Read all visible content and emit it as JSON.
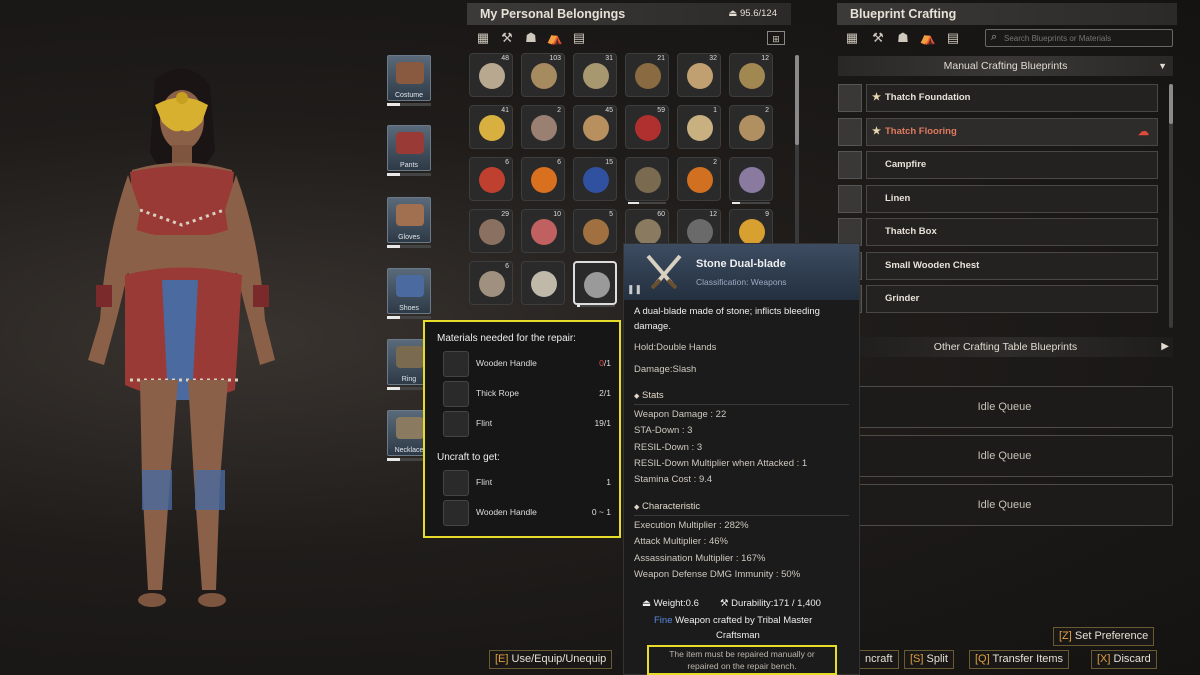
{
  "inventory": {
    "title": "My Personal Belongings",
    "weight": "95.6/124",
    "rows": [
      [
        {
          "count": "48",
          "icon": "tooth-icon",
          "color": "#b8a890"
        },
        {
          "count": "103",
          "icon": "rope-fiber-icon",
          "color": "#a68a60"
        },
        {
          "count": "31",
          "icon": "grass-icon",
          "color": "#a89870"
        },
        {
          "count": "21",
          "icon": "seeds-icon",
          "color": "#8a6a40"
        },
        {
          "count": "32",
          "icon": "mushroom-icon",
          "color": "#c0a070"
        },
        {
          "count": "12",
          "icon": "stick-icon",
          "color": "#a08850"
        }
      ],
      [
        {
          "count": "41",
          "icon": "corn-icon",
          "color": "#d8b040"
        },
        {
          "count": "2",
          "icon": "bread-icon",
          "color": "#9a8070"
        },
        {
          "count": "45",
          "icon": "potato-icon",
          "color": "#b89060"
        },
        {
          "count": "59",
          "icon": "berries-icon",
          "color": "#b03030"
        },
        {
          "count": "1",
          "icon": "flatbread-icon",
          "color": "#c8b080"
        },
        {
          "count": "2",
          "icon": "thick-rope-icon",
          "color": "#b09060"
        }
      ],
      [
        {
          "count": "6",
          "icon": "apple-icon",
          "color": "#c04030"
        },
        {
          "count": "6",
          "icon": "pumpkin-icon",
          "color": "#d87020"
        },
        {
          "count": "15",
          "icon": "potion-icon",
          "color": "#3050a0"
        },
        {
          "count": "",
          "icon": "bucket-icon",
          "color": "#7a6a50"
        },
        {
          "count": "2",
          "icon": "carrot-icon",
          "color": "#d07020"
        },
        {
          "count": "",
          "icon": "dual-blade-icon",
          "color": "#8a7aa0"
        }
      ],
      [
        {
          "count": "29",
          "icon": "hide-icon",
          "color": "#8a7060"
        },
        {
          "count": "10",
          "icon": "meat-icon",
          "color": "#c06060"
        },
        {
          "count": "5",
          "icon": "root-icon",
          "color": "#a07040"
        },
        {
          "count": "60",
          "icon": "hay-icon",
          "color": "#8a7a60"
        },
        {
          "count": "12",
          "icon": "feather-icon",
          "color": "#6a6a6a"
        },
        {
          "count": "9",
          "icon": "banana-icon",
          "color": "#d8a030"
        }
      ],
      [
        {
          "count": "6",
          "icon": "stone-icon",
          "color": "#a09080"
        },
        {
          "count": "",
          "icon": "linen-icon",
          "color": "#c0b8a8"
        },
        {
          "count": "",
          "icon": "stone-dual-blade-icon",
          "color": "#9a9a9a"
        }
      ]
    ]
  },
  "equipment": [
    {
      "label": "Costume",
      "icon": "necklace-icon"
    },
    {
      "label": "Pants",
      "icon": "pants-icon"
    },
    {
      "label": "Gloves",
      "icon": "gloves-icon"
    },
    {
      "label": "Shoes",
      "icon": "shoes-icon"
    },
    {
      "label": "Ring",
      "icon": "ring-icon"
    },
    {
      "label": "Necklace",
      "icon": "necklace-icon"
    }
  ],
  "crafting": {
    "title": "Blueprint Crafting",
    "search_placeholder": "Search Blueprints or Materials",
    "manual_header": "Manual Crafting Blueprints",
    "other_header": "Other Crafting Table Blueprints",
    "blueprints": [
      {
        "name": "Thatch Foundation",
        "starred": true,
        "active": false
      },
      {
        "name": "Thatch Flooring",
        "starred": true,
        "active": true
      },
      {
        "name": "Campfire",
        "starred": false,
        "active": false
      },
      {
        "name": "Linen",
        "starred": false,
        "active": false
      },
      {
        "name": "Thatch Box",
        "starred": false,
        "active": false
      },
      {
        "name": "Small Wooden Chest",
        "starred": false,
        "active": false
      },
      {
        "name": "Grinder",
        "starred": false,
        "active": false
      }
    ],
    "queues": [
      "Idle Queue",
      "Idle Queue",
      "Idle Queue"
    ]
  },
  "tooltip": {
    "name": "Stone Dual-blade",
    "classification": "Classification: Weapons",
    "description_line1": "A dual-blade made of stone; inflicts bleeding",
    "description_line2": "damage.",
    "hold": "Hold:Double Hands",
    "damage": "Damage:Slash",
    "stats_header": "Stats",
    "stats": [
      "Weapon Damage : 22",
      "STA-Down : 3",
      "RESIL-Down : 3",
      "RESIL-Down Multiplier when Attacked : 1",
      "Stamina Cost : 9.4"
    ],
    "char_header": "Characteristic",
    "characteristics": [
      "Execution Multiplier : 282%",
      "Attack Multiplier : 46%",
      "Assassination Multiplier : 167%",
      "Weapon Defense DMG Immunity : 50%"
    ],
    "weight": "Weight:0.6",
    "durability": "Durability:171 / 1,400",
    "quality": "Fine",
    "crafted_by": " Weapon crafted by Tribal Master",
    "crafted_by2": "Craftsman",
    "repair_note1": "The item must be repaired manually or",
    "repair_note2": "repaired on the repair bench.",
    "colors": {
      "quality": "#5a8ae0",
      "note_border": "#e8dc2a"
    }
  },
  "repair": {
    "title": "Materials needed for the repair:",
    "materials": [
      {
        "name": "Wooden Handle",
        "qty_have": "0",
        "qty_need": "/1",
        "short": true
      },
      {
        "name": "Thick Rope",
        "qty": "2/1"
      },
      {
        "name": "Flint",
        "qty": "19/1"
      }
    ],
    "uncraft_title": "Uncraft to get:",
    "uncraft": [
      {
        "name": "Flint",
        "qty": "1"
      },
      {
        "name": "Wooden Handle",
        "qty": "0 ~ 1"
      }
    ]
  },
  "bottom_bar": {
    "use_key": "[E]",
    "use_label": "Use/Equip/Unequip",
    "uncraft_label": "ncraft",
    "split_key": "[S]",
    "split_label": "Split",
    "transfer_key": "[Q]",
    "transfer_label": "Transfer Items",
    "discard_key": "[X]",
    "discard_label": "Discard",
    "pref_key": "[Z]",
    "pref_label": "Set Preference"
  }
}
